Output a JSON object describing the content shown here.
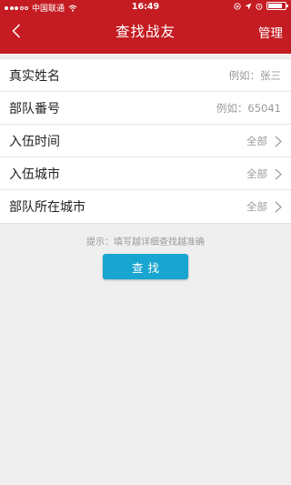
{
  "status_bar": {
    "carrier": "中国联通",
    "time": "16:49",
    "battery_level": 0.85
  },
  "nav": {
    "title": "查找战友",
    "manage_label": "管理",
    "back_icon": "chevron-left-icon"
  },
  "form": {
    "fields": [
      {
        "label": "真实姓名",
        "value": "例如：张三"
      },
      {
        "label": "部队番号",
        "value": "例如：65041"
      },
      {
        "label": "入伍时间",
        "value": "全部"
      },
      {
        "label": "入伍城市",
        "value": "全部"
      },
      {
        "label": "部队所在城市",
        "value": "全部"
      }
    ]
  },
  "hint": "提示：填写越详细查找越准确",
  "search_button": "查找",
  "colors": {
    "header": "#c41c22",
    "button": "#18a5cf",
    "background": "#efefef"
  }
}
